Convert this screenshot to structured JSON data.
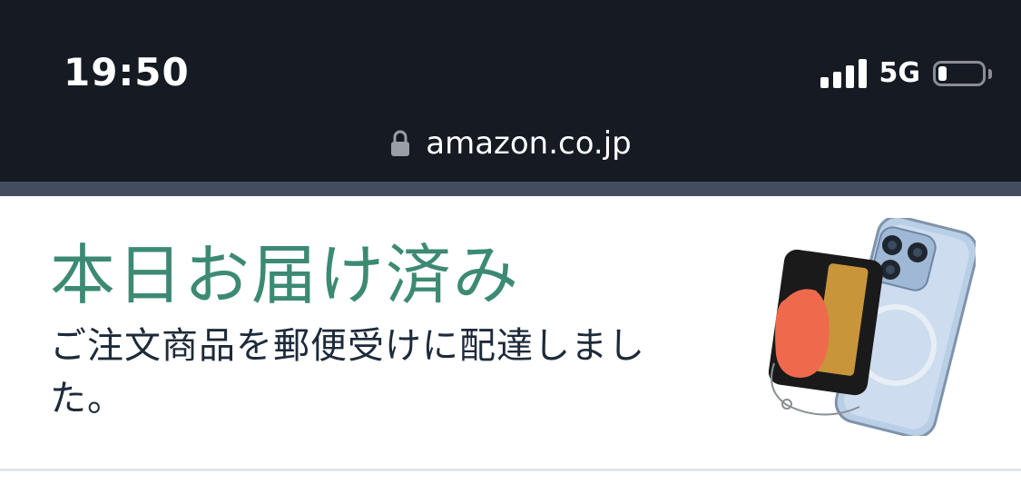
{
  "status_bar": {
    "time": "19:50",
    "network": "5G",
    "signal_bars": 4,
    "battery_level": 0.15
  },
  "address_bar": {
    "url": "amazon.co.jp",
    "lock_icon": "lock-icon"
  },
  "delivery_card": {
    "headline": "本日お届け済み",
    "message": "ご注文商品を郵便受けに配達しました。",
    "product_image": "phone-case-with-card-grip",
    "headline_color": "#3c8a73"
  },
  "colors": {
    "topbar": "#151a23",
    "band": "#434d5f",
    "text": "#1d2a3a"
  }
}
